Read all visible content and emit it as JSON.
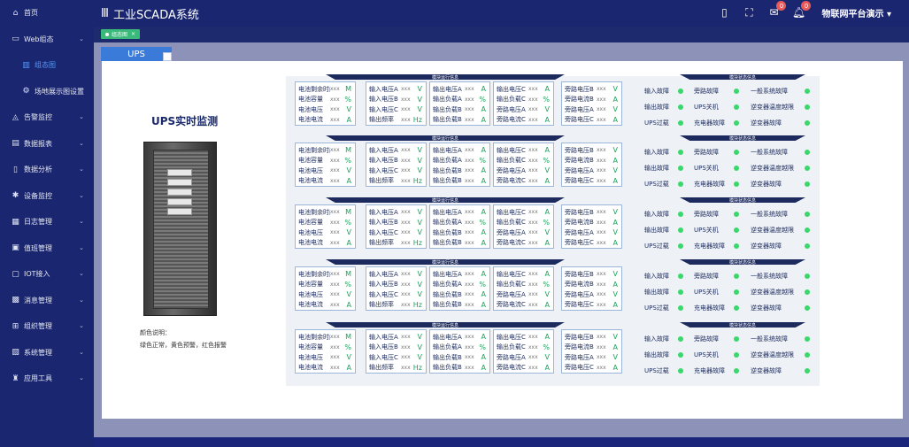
{
  "sidebar": {
    "items": [
      {
        "label": "首页",
        "icon": "home-icon",
        "chev": false
      },
      {
        "label": "Web组态",
        "icon": "monitor-icon",
        "chev": true
      },
      {
        "label": "组态图",
        "icon": "chart-bar-icon",
        "sub": true,
        "active": true
      },
      {
        "label": "场地展示图设置",
        "icon": "gear-icon",
        "sub": true
      },
      {
        "label": "告警监控",
        "icon": "bell-icon",
        "chev": true
      },
      {
        "label": "数据报表",
        "icon": "report-icon",
        "chev": true
      },
      {
        "label": "数据分析",
        "icon": "phone-icon",
        "chev": true
      },
      {
        "label": "设备监控",
        "icon": "settings-icon",
        "chev": true
      },
      {
        "label": "日志管理",
        "icon": "log-icon",
        "chev": true
      },
      {
        "label": "值班管理",
        "icon": "duty-icon",
        "chev": true
      },
      {
        "label": "IOT接入",
        "icon": "iot-icon",
        "chev": true
      },
      {
        "label": "消息管理",
        "icon": "message-icon",
        "chev": true
      },
      {
        "label": "组织管理",
        "icon": "org-icon",
        "chev": true
      },
      {
        "label": "系统管理",
        "icon": "system-icon",
        "chev": true
      },
      {
        "label": "应用工具",
        "icon": "tool-icon",
        "chev": true
      }
    ]
  },
  "header": {
    "menu_icon": "Ⅲ",
    "title": "工业SCADA系统",
    "badge_mail": "0",
    "badge_bell": "0",
    "user": "物联网平台演示",
    "user_chev": "▾"
  },
  "tabs": [
    {
      "label": "组态图",
      "close": "×"
    }
  ],
  "page": {
    "ups_tab": "UPS",
    "monitor_title": "UPS实时监测",
    "legend_title": "颜色说明：",
    "legend_text": "绿色正常，黄色预警，红色报警"
  },
  "section_titles": {
    "left": "模块运行信息",
    "right": "模块状态信息"
  },
  "cards": [
    [
      [
        "电池剩余时间",
        "xxx",
        "M"
      ],
      [
        "电池容量",
        "xxx",
        "%"
      ],
      [
        "电池电压",
        "xxx",
        "V"
      ],
      [
        "电池电流",
        "xxx",
        "A"
      ]
    ],
    [
      [
        "输入电压A",
        "xxx",
        "V"
      ],
      [
        "输入电压B",
        "xxx",
        "V"
      ],
      [
        "输入电压C",
        "xxx",
        "V"
      ],
      [
        "输出频率",
        "xxx",
        "Hz"
      ]
    ],
    [
      [
        "输出电压A",
        "xxx",
        "A"
      ],
      [
        "输出负载A",
        "xxx",
        "%"
      ],
      [
        "输出负载B",
        "xxx",
        "A"
      ],
      [
        "输出负载B",
        "xxx",
        "A"
      ]
    ],
    [
      [
        "输出电压C",
        "xxx",
        "A"
      ],
      [
        "输出负载C",
        "xxx",
        "%"
      ],
      [
        "旁路电压A",
        "xxx",
        "V"
      ],
      [
        "旁路电流C",
        "xxx",
        "A"
      ]
    ],
    [
      [
        "旁路电压B",
        "xxx",
        "V"
      ],
      [
        "旁路电流B",
        "xxx",
        "A"
      ],
      [
        "旁路电压A",
        "xxx",
        "V"
      ],
      [
        "旁路电压C",
        "xxx",
        "A"
      ]
    ]
  ],
  "status": [
    [
      "输入故障",
      "旁路故障",
      "一般系统故障"
    ],
    [
      "输出故障",
      "UPS关机",
      "逆变器温度越限"
    ],
    [
      "UPS过载",
      "充电器故障",
      "逆变器故障"
    ]
  ],
  "colors": {
    "status_ok": "#38d86a",
    "accent": "#3a7ad8"
  }
}
